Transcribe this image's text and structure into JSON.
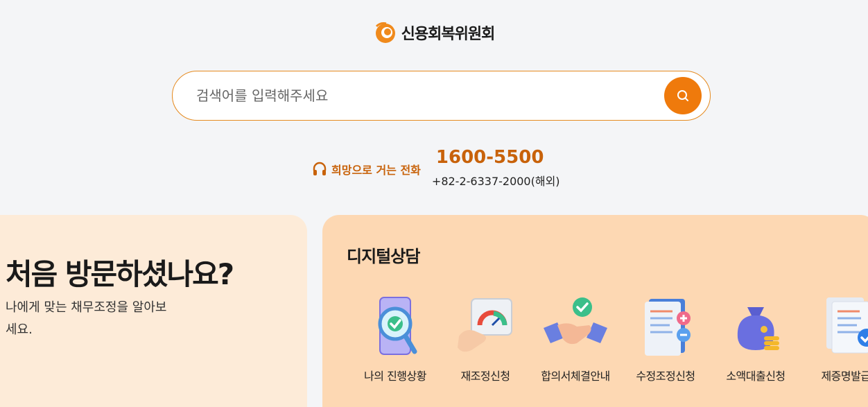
{
  "logo": {
    "text": "신용회복위원회",
    "icon": "orange-swirl-logo"
  },
  "search": {
    "placeholder": "검색어를 입력해주세요",
    "icon": "search-icon"
  },
  "phone": {
    "label": "희망으로 거는 전화",
    "icon": "headset-icon",
    "main_number": "1600-5500",
    "overseas_number": "+82-2-6337-2000(해외)"
  },
  "intro_card": {
    "title": "처음 방문하셨나요?",
    "description": "나에게 맞는 채무조정을 알아보세요."
  },
  "digital_card": {
    "title": "디지털상담",
    "services": [
      {
        "label": "나의 진행상황",
        "icon": "magnifier-check-icon"
      },
      {
        "label": "재조정신청",
        "icon": "puzzle-gauge-icon"
      },
      {
        "label": "합의서체결안내",
        "icon": "handshake-check-icon"
      },
      {
        "label": "수정조정신청",
        "icon": "document-plus-minus-icon"
      },
      {
        "label": "소액대출신청",
        "icon": "money-bag-icon"
      },
      {
        "label": "제증명발급",
        "icon": "document-check-icon"
      }
    ]
  },
  "colors": {
    "accent": "#ef7a0c",
    "accent_text": "#c8620a",
    "card_light": "#fdebd8",
    "card_peach": "#fdd8b3"
  }
}
